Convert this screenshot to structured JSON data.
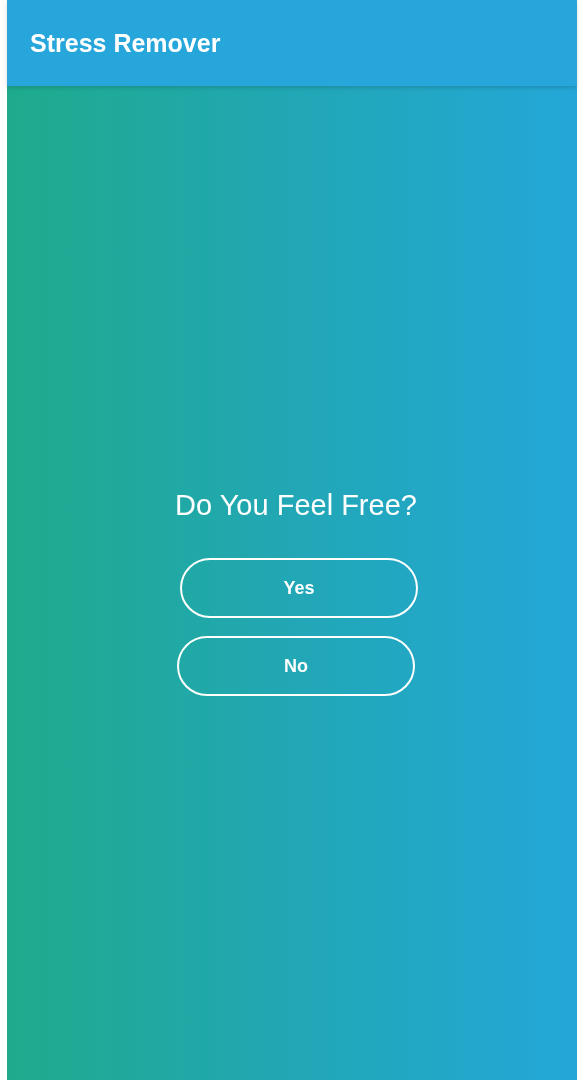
{
  "app_bar": {
    "title": "Stress Remover"
  },
  "question": "Do You Feel Free?",
  "buttons": [
    {
      "label": "Yes"
    },
    {
      "label": "No"
    }
  ]
}
